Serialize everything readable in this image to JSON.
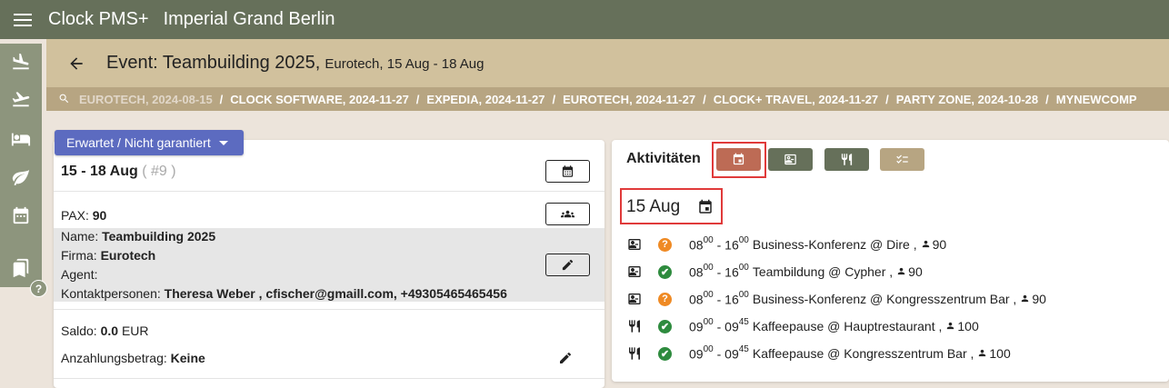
{
  "topbar": {
    "app_title": "Clock PMS+",
    "hotel_name": "Imperial Grand Berlin"
  },
  "sidenav": {
    "icons": [
      "flight-land-icon",
      "flight-takeoff-icon",
      "hotel-bed-icon",
      "leaf-icon",
      "calendar-icon",
      "bookmarks-icon"
    ],
    "help_label": "?"
  },
  "event": {
    "title": "Event: Teambuilding 2025,",
    "subtitle": "Eurotech, 15 Aug - 18 Aug"
  },
  "breadcrumbs": [
    "EUROTECH, 2024-08-15",
    "CLOCK SOFTWARE, 2024-11-27",
    "EXPEDIA, 2024-11-27",
    "EUROTECH, 2024-11-27",
    "CLOCK+ TRAVEL, 2024-11-27",
    "PARTY ZONE, 2024-10-28",
    "MYNEWCOMP"
  ],
  "breadcrumb_separator": "/",
  "status": {
    "label": "Erwartet / Nicht garantiert"
  },
  "details": {
    "dates": "15 - 18 Aug",
    "ref": "( #9 )",
    "pax_label": "PAX:",
    "pax_value": "90",
    "name_label": "Name:",
    "name_value": "Teambuilding 2025",
    "firma_label": "Firma:",
    "firma_value": "Eurotech",
    "agent_label": "Agent:",
    "kontakt_label": "Kontaktpersonen:",
    "kontakt_value": "Theresa Weber , cfischer@gmaill.com, +49305465465456",
    "saldo_label": "Saldo:",
    "saldo_value": "0.0",
    "saldo_currency": "EUR",
    "anzahlung_label": "Anzahlungsbetrag:",
    "anzahlung_value": "Keine"
  },
  "activities": {
    "label": "Aktivitäten",
    "tabs": [
      {
        "name": "calendar",
        "color": "#bd6b55",
        "selected": true
      },
      {
        "name": "conference",
        "color": "#66705a",
        "selected": false
      },
      {
        "name": "restaurant",
        "color": "#66705a",
        "selected": false
      },
      {
        "name": "checklist",
        "color": "#b7a582",
        "selected": false
      }
    ],
    "date": "15 Aug",
    "items": [
      {
        "type": "conference",
        "status": "pending",
        "status_glyph": "?",
        "start_h": "08",
        "start_m": "00",
        "end_h": "16",
        "end_m": "00",
        "title": "Business-Konferenz @ Dire ,",
        "pax": "90"
      },
      {
        "type": "conference",
        "status": "confirmed",
        "status_glyph": "✔",
        "start_h": "08",
        "start_m": "00",
        "end_h": "16",
        "end_m": "00",
        "title": "Teambildung @ Cypher ,",
        "pax": "90"
      },
      {
        "type": "conference",
        "status": "pending",
        "status_glyph": "?",
        "start_h": "08",
        "start_m": "00",
        "end_h": "16",
        "end_m": "00",
        "title": "Business-Konferenz @ Kongresszentrum Bar ,",
        "pax": "90"
      },
      {
        "type": "restaurant",
        "status": "confirmed",
        "status_glyph": "✔",
        "start_h": "09",
        "start_m": "00",
        "end_h": "09",
        "end_m": "45",
        "title": "Kaffeepause @ Hauptrestaurant ,",
        "pax": "100"
      },
      {
        "type": "restaurant",
        "status": "confirmed",
        "status_glyph": "✔",
        "start_h": "09",
        "start_m": "00",
        "end_h": "09",
        "end_m": "45",
        "title": "Kaffeepause @ Kongresszentrum Bar ,",
        "pax": "100"
      }
    ]
  },
  "colors": {
    "topbar": "#66705a",
    "header": "#d1c19d",
    "crumbs": "#b7a582",
    "status_button": "#5c6bc0",
    "highlight": "#e03a3a"
  }
}
